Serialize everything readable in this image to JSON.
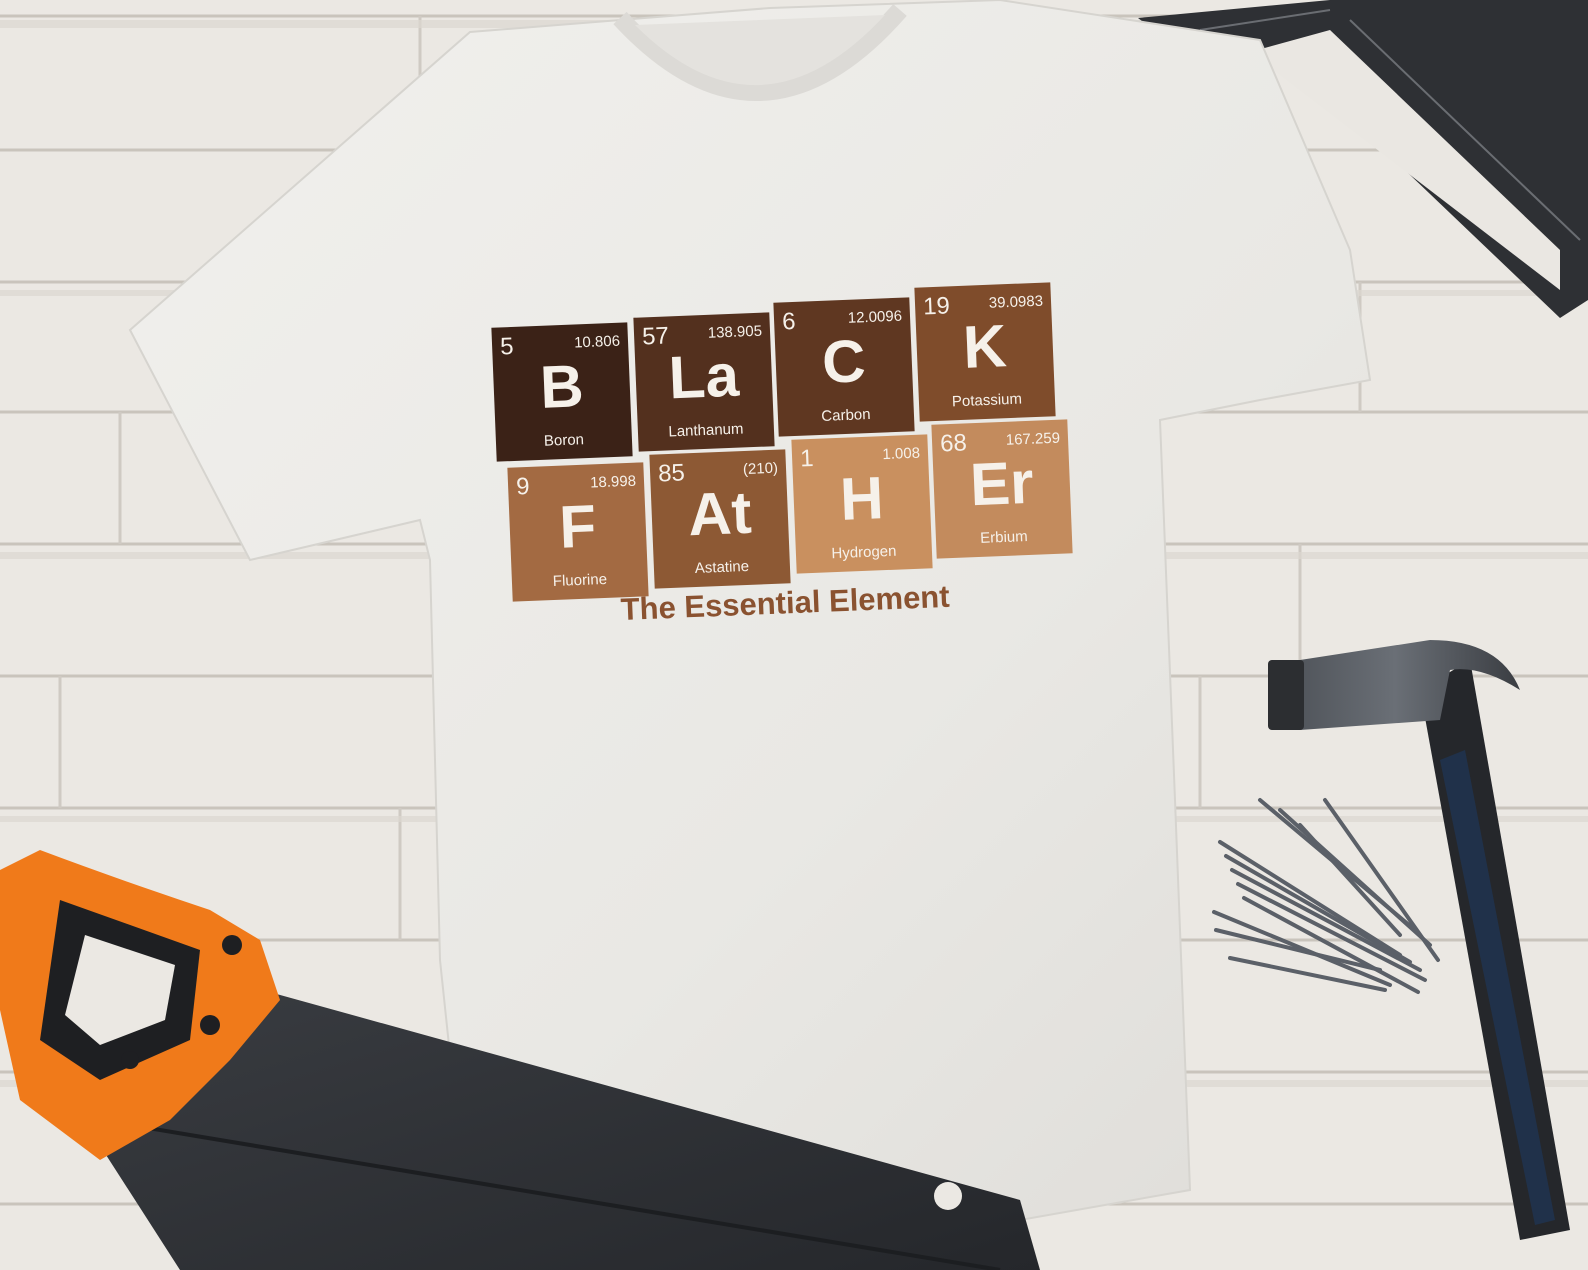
{
  "shirt_design": {
    "tiles_row1": [
      {
        "number": "5",
        "mass": "10.806",
        "symbol": "B",
        "name": "Boron",
        "color": "#3b2217"
      },
      {
        "number": "57",
        "mass": "138.905",
        "symbol": "La",
        "name": "Lanthanum",
        "color": "#53301e"
      },
      {
        "number": "6",
        "mass": "12.0096",
        "symbol": "C",
        "name": "Carbon",
        "color": "#5f3721"
      },
      {
        "number": "19",
        "mass": "39.0983",
        "symbol": "K",
        "name": "Potassium",
        "color": "#7f4c2b"
      }
    ],
    "tiles_row2": [
      {
        "number": "9",
        "mass": "18.998",
        "symbol": "F",
        "name": "Fluorine",
        "color": "#a36a42"
      },
      {
        "number": "85",
        "mass": "(210)",
        "symbol": "At",
        "name": "Astatine",
        "color": "#8d5934"
      },
      {
        "number": "1",
        "mass": "1.008",
        "symbol": "H",
        "name": "Hydrogen",
        "color": "#c9905f"
      },
      {
        "number": "68",
        "mass": "167.259",
        "symbol": "Er",
        "name": "Erbium",
        "color": "#c38b5d"
      }
    ],
    "tagline": "The Essential Element",
    "tagline_color": "#8a5230"
  },
  "colors": {
    "background_wood": "#ece9e4",
    "shirt": "#eeedea",
    "saw_handle": "#f07a1a",
    "tool_dark": "#2c2e31"
  },
  "objects": [
    "white-t-shirt",
    "hand-saw",
    "claw-hammer",
    "nails",
    "speed-square"
  ]
}
